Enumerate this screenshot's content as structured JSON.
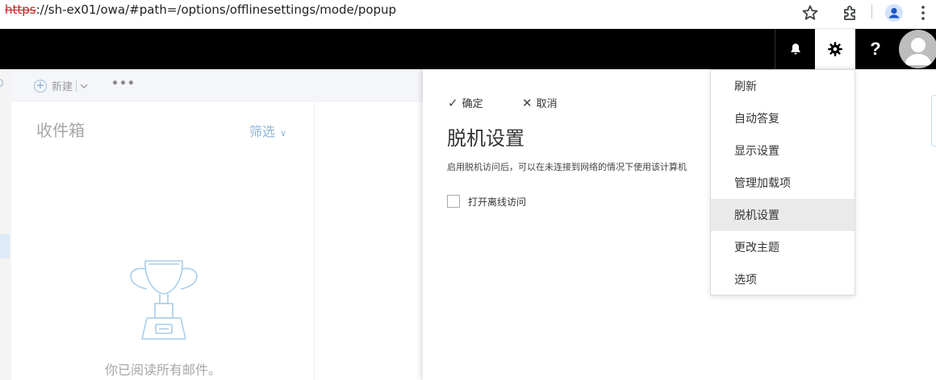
{
  "browser": {
    "url_scheme": "https",
    "url_rest": "://sh-ex01/owa/#path=/options/offlinesettings/mode/popup"
  },
  "topbar": {
    "icons": [
      "bell-icon",
      "gear-icon",
      "help-icon",
      "avatar"
    ],
    "help_glyph": "?"
  },
  "commandbar": {
    "new_label": "新建"
  },
  "folder": {
    "title": "收件箱",
    "filter_label": "筛选",
    "empty_message": "你已阅读所有邮件。"
  },
  "panel": {
    "ok_label": "确定",
    "cancel_label": "取消",
    "heading": "脱机设置",
    "description": "启用脱机访问后，可以在未连接到网络的情况下使用该计算机",
    "checkbox_label": "打开离线访问",
    "checkbox_checked": false
  },
  "menu": {
    "items": [
      {
        "label": "刷新"
      },
      {
        "label": "自动答复"
      },
      {
        "label": "显示设置"
      },
      {
        "label": "管理加载项"
      },
      {
        "label": "脱机设置"
      },
      {
        "label": "更改主题"
      },
      {
        "label": "选项"
      }
    ],
    "active_index": 4
  },
  "colors": {
    "topbar_bg": "#000000",
    "accent_blue": "#8fb6d9",
    "menu_active_bg": "#eaeaea"
  }
}
